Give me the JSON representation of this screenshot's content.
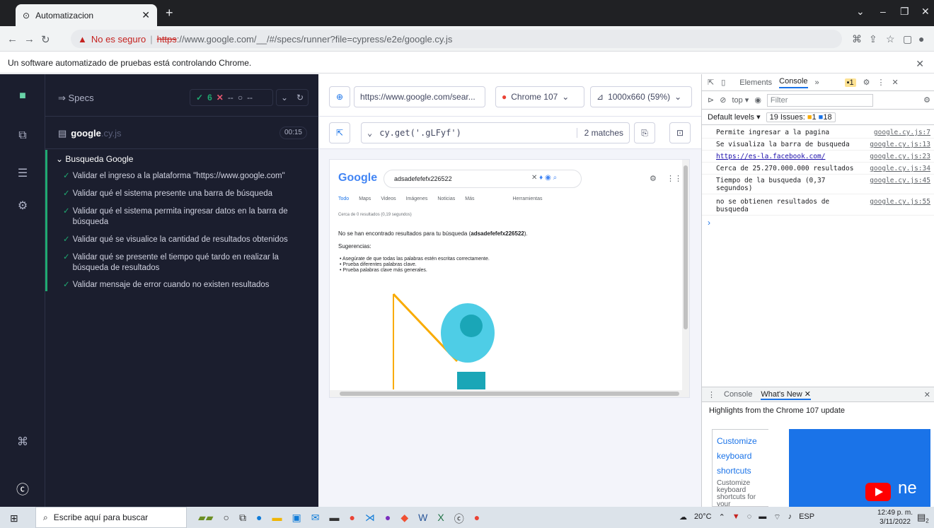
{
  "browser": {
    "tab_title": "Automatizacion",
    "security_label": "No es seguro",
    "url_scheme": "https",
    "url_rest": "://www.google.com/__/#/specs/runner?file=cypress/e2e/google.cy.js",
    "automation_notice": "Un software automatizado de pruebas está controlando Chrome."
  },
  "specs": {
    "header": "Specs",
    "passed": "6",
    "failed": "--",
    "pending": "--",
    "file_name": "google",
    "file_ext": ".cy.js",
    "duration": "00:15",
    "suite": "Busqueda Google",
    "tests": [
      "Validar el ingreso a la plataforma \"https://www.google.com\"",
      "Validar qué el sistema presente una barra de búsqueda",
      "Validar qué el sistema permita ingresar datos en la barra de búsqueda",
      "Validar qué se visualice la cantidad de resultados obtenidos",
      "Validar qué se presente el tiempo qué tardo en realizar la búsqueda de resultados",
      "Validar mensaje de error cuando no existen resultados"
    ]
  },
  "runner": {
    "aut_url": "https://www.google.com/sear...",
    "browser": "Chrome 107",
    "viewport": "1000x660 (59%)",
    "selector": "cy.get('.gLFyf')",
    "matches": "2 matches"
  },
  "aut": {
    "logo": "Google",
    "query": "adsadefefefx226522",
    "tabs": [
      "Todo",
      "Maps",
      "Videos",
      "Imágenes",
      "Noticias",
      "Más",
      "Herramientas"
    ],
    "result_count": "Cerca de 0 resultados (0,19 segundos)",
    "no_results_prefix": "No se han encontrado resultados para tu búsqueda (",
    "no_results_query": "adsadefefefx226522",
    "no_results_suffix": ").",
    "suggestions_title": "Sugerencias:",
    "suggestions": [
      "Asegúrate de que todas las palabras estén escritas correctamente.",
      "Prueba diferentes palabras clave.",
      "Prueba palabras clave más generales."
    ]
  },
  "devtools": {
    "tabs": [
      "Elements",
      "Console",
      "»"
    ],
    "issue_badge": "1",
    "context": "top ▾",
    "filter_placeholder": "Filter",
    "levels": "Default levels ▾",
    "issues_label": "19 Issues:",
    "issues_warn": "1",
    "issues_info": "18",
    "logs": [
      {
        "msg": "Permite ingresar a la pagina",
        "src": "google.cy.js:7"
      },
      {
        "msg": "Se visualiza la barra de busqueda",
        "src": "google.cy.js:13"
      },
      {
        "msg": "https://es-la.facebook.com/",
        "src": "google.cy.js:23"
      },
      {
        "msg": "Cerca de 25.270.000.000 resultados",
        "src": "google.cy.js:34"
      },
      {
        "msg": "Tiempo de la busqueda (0,37 segundos)",
        "src": "google.cy.js:45"
      },
      {
        "msg": "no se obtienen resultados de busqueda",
        "src": "google.cy.js:55"
      }
    ],
    "drawer_tabs": [
      "Console",
      "What's New"
    ],
    "highlights": "Highlights from the Chrome 107 update",
    "card_big": [
      "Customize",
      "keyboard",
      "shortcuts"
    ],
    "card_small": "Customize keyboard shortcuts for your",
    "video_text": "ne"
  },
  "taskbar": {
    "search_placeholder": "Escribe aquí para buscar",
    "temperature": "20°C",
    "language": "ESP",
    "time": "12:49 p. m.",
    "date": "3/11/2022",
    "notification_count": "2"
  }
}
